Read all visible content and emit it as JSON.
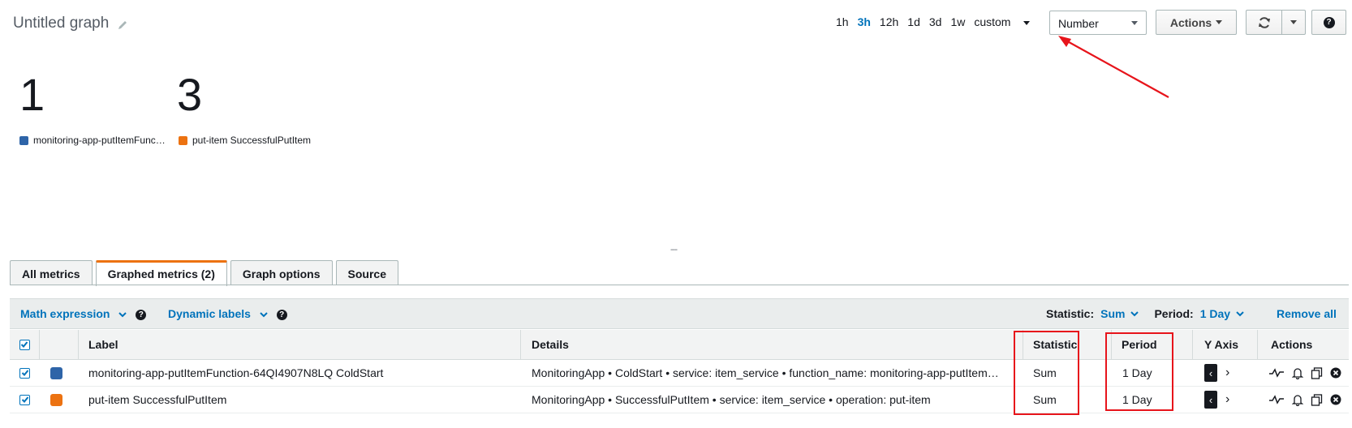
{
  "header": {
    "title": "Untitled graph",
    "time_ranges": [
      "1h",
      "3h",
      "12h",
      "1d",
      "3d",
      "1w"
    ],
    "active_time_range": "3h",
    "custom_label": "custom",
    "view_type": "Number",
    "actions_label": "Actions"
  },
  "numbers": [
    {
      "value": "1",
      "label": "monitoring-app-putItemFunc…",
      "color": "#2e64a8"
    },
    {
      "value": "3",
      "label": "put-item SuccessfulPutItem",
      "color": "#ec7211"
    }
  ],
  "drag_handle": "---",
  "tabs": [
    {
      "label": "All metrics"
    },
    {
      "label": "Graphed metrics (2)"
    },
    {
      "label": "Graph options"
    },
    {
      "label": "Source"
    }
  ],
  "toolbar": {
    "math_expression": "Math expression",
    "dynamic_labels": "Dynamic labels",
    "statistic_label": "Statistic:",
    "statistic_value": "Sum",
    "period_label": "Period:",
    "period_value": "1 Day",
    "remove_all": "Remove all"
  },
  "table": {
    "headers": {
      "label": "Label",
      "details": "Details",
      "statistic": "Statistic",
      "period": "Period",
      "y_axis": "Y Axis",
      "actions": "Actions"
    },
    "rows": [
      {
        "label": "monitoring-app-putItemFunction-64QI4907N8LQ ColdStart",
        "details": "MonitoringApp • ColdStart • service: item_service • function_name: monitoring-app-putItem…",
        "statistic": "Sum",
        "period": "1 Day",
        "color": "#2e64a8"
      },
      {
        "label": "put-item SuccessfulPutItem",
        "details": "MonitoringApp • SuccessfulPutItem • service: item_service • operation: put-item",
        "statistic": "Sum",
        "period": "1 Day",
        "color": "#ec7211"
      }
    ]
  },
  "annotation_color": "#e7141b"
}
